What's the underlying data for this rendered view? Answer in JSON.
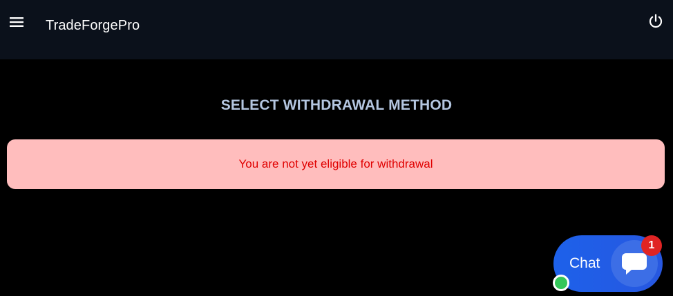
{
  "header": {
    "brand": "TradeForgePro",
    "menu_icon": "hamburger-menu-icon",
    "power_icon": "power-icon"
  },
  "main": {
    "title": "SELECT WITHDRAWAL METHOD",
    "alert_message": "You are not yet eligible for withdrawal"
  },
  "chat": {
    "label": "Chat",
    "unread_count": "1",
    "icon": "chat-bubble-icon"
  },
  "colors": {
    "header_bg": "#0b111b",
    "page_bg": "#000000",
    "title_text": "#b4c6e0",
    "alert_bg": "#ffbdbd",
    "alert_text": "#e00000",
    "chat_bg": "#1d61ea",
    "badge_bg": "#e02424",
    "online": "#34c759"
  }
}
